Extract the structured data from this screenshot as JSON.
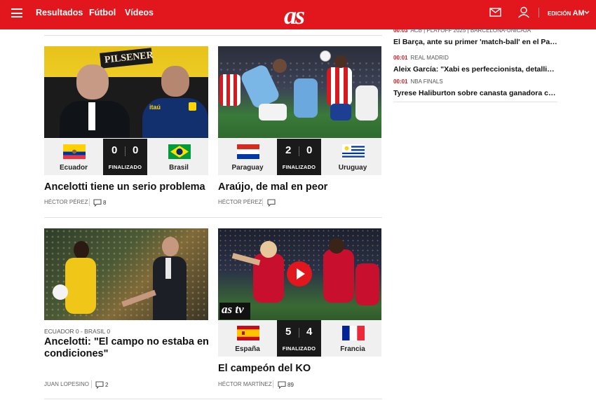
{
  "header": {
    "nav": [
      "Resultados",
      "Fútbol",
      "Vídeos"
    ],
    "logo": "as",
    "edition_label": "EDICIÓN",
    "edition_value": "AM",
    "brand_color": "#e2171d"
  },
  "sidebar": {
    "items": [
      {
        "time": "00:03",
        "section": "ACB | PLAYOFF 2025 | BARCELONA-UNICAJA",
        "title": "El Barça, ante su primer 'match-ball' en el Pal..."
      },
      {
        "time": "00:01",
        "section": "REAL MADRID",
        "title": "Aleix García: \"Xabi es perfeccionista, detallist..."
      },
      {
        "time": "00:01",
        "section": "NBA FINALS",
        "title": "Tyrese Haliburton sobre canasta ganadora co..."
      }
    ]
  },
  "cards": [
    {
      "home": "Ecuador",
      "home_score": "0",
      "away": "Brasil",
      "away_score": "0",
      "status": "FINALIZADO",
      "headline": "Ancelotti tiene un serio problema",
      "author": "HÉCTOR PÉREZ",
      "comments": "8"
    },
    {
      "home": "Paraguay",
      "home_score": "2",
      "away": "Uruguay",
      "away_score": "0",
      "status": "FINALIZADO",
      "headline": "Araújo, de mal en peor",
      "author": "HÉCTOR PÉREZ",
      "comments": ""
    },
    {
      "kicker": "ECUADOR 0 - BRASIL 0",
      "headline": "Ancelotti: \"El campo no estaba en condiciones\"",
      "author": "JUAN LOPESINO",
      "comments": "2"
    },
    {
      "home": "España",
      "home_score": "5",
      "away": "Francia",
      "away_score": "4",
      "status": "FINALIZADO",
      "headline": "El campeón del KO",
      "author": "HÉCTOR MARTÍNEZ",
      "comments": "89",
      "badge": "as tv"
    }
  ],
  "image_text": {
    "pilsener": "PILSENER",
    "itau": "itaú"
  }
}
